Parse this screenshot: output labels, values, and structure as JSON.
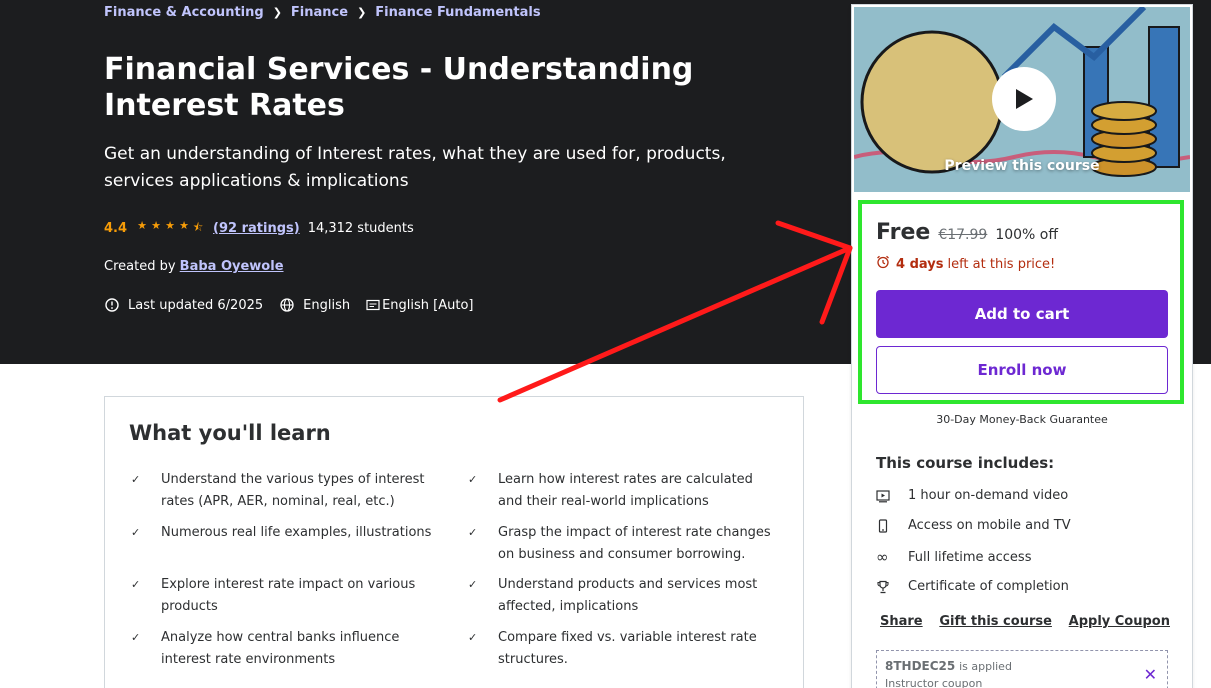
{
  "breadcrumb": [
    "Finance & Accounting",
    "Finance",
    "Finance Fundamentals"
  ],
  "course": {
    "title": "Financial Services - Understanding Interest Rates",
    "subtitle": "Get an understanding of Interest rates, what they are used for, products, services applications & implications",
    "rating": "4.4",
    "stars_filled": 4.5,
    "ratings_count": "(92 ratings)",
    "students": "14,312 students",
    "created_by_label": "Created by",
    "instructor": "Baba Oyewole",
    "last_updated": "Last updated 6/2025",
    "language": "English",
    "captions": "English [Auto]"
  },
  "learn": {
    "title": "What you'll learn",
    "items": [
      "Understand the various types of interest rates (APR, AER, nominal, real, etc.)",
      "Learn how interest rates are calculated and their real-world implications",
      "Numerous real life examples, illustrations",
      "Grasp the impact of interest rate changes on business and consumer borrowing.",
      "Explore interest rate impact on various products",
      "Understand products and services most affected, implications",
      "Analyze how central banks influence interest rate environments",
      "Compare fixed vs. variable interest rate structures."
    ]
  },
  "sidebar": {
    "preview_label": "Preview this course",
    "price_free": "Free",
    "price_original": "€17.99",
    "discount": "100% off",
    "timer_days": "4 days",
    "timer_suffix": "left at this price!",
    "add_to_cart": "Add to cart",
    "enroll_now": "Enroll now",
    "guarantee": "30-Day Money-Back Guarantee",
    "includes_title": "This course includes:",
    "includes": [
      {
        "icon": "video-icon",
        "label": "1 hour on-demand video"
      },
      {
        "icon": "mobile-icon",
        "label": "Access on mobile and TV"
      },
      {
        "icon": "infinity-icon",
        "label": "Full lifetime access"
      },
      {
        "icon": "trophy-icon",
        "label": "Certificate of completion"
      }
    ],
    "share": "Share",
    "gift": "Gift this course",
    "apply_coupon": "Apply Coupon",
    "coupon_code": "8THDEC25",
    "coupon_applied": "is applied",
    "coupon_sub": "Instructor coupon"
  },
  "colors": {
    "accent": "#6d28d2",
    "hero_bg": "#1c1d1f",
    "link_light": "#c0c4fc",
    "star": "#f69c08",
    "highlight": "#2ee62e",
    "arrow": "#ff1a1a"
  }
}
